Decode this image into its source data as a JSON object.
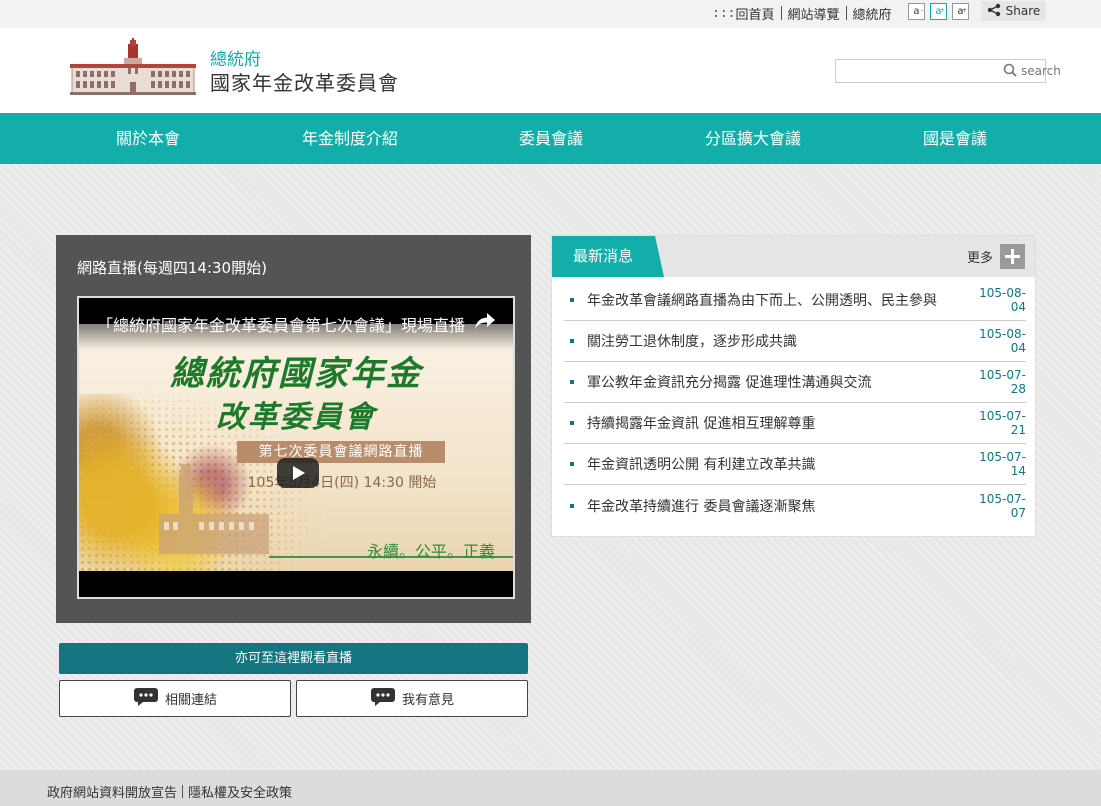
{
  "toplinks": {
    "accesskey": ":::",
    "home": "回首頁",
    "sitemap": "網站導覽",
    "president": "總統府"
  },
  "fontsize": {
    "small": "a",
    "medium": "a",
    "large": "a",
    "active": "medium"
  },
  "share": {
    "label": "Share"
  },
  "header": {
    "org_line1": "總統府",
    "org_line2": "國家年金改革委員會"
  },
  "search": {
    "placeholder": "",
    "button_label": "search"
  },
  "nav": {
    "items": [
      {
        "label": "關於本會"
      },
      {
        "label": "年金制度介紹"
      },
      {
        "label": "委員會議"
      },
      {
        "label": "分區擴大會議"
      },
      {
        "label": "國是會議"
      }
    ]
  },
  "live": {
    "title": "網路直播(每週四14:30開始)",
    "video_title": "「總統府國家年金改革委員會第七次會議」現場直播",
    "thumb_line1": "總統府國家年金",
    "thumb_line2": "改革委員會",
    "thumb_band": "第七次委員會議網路直播",
    "thumb_date": "105年8月4日(四) 14:30 開始",
    "thumb_slogan": "永續。公平。正義",
    "watch_button": "亦可至這裡觀看直播",
    "related_links": "相關連結",
    "feedback": "我有意見"
  },
  "news": {
    "tab": "最新消息",
    "more": "更多",
    "items": [
      {
        "title": "年金改革會議網路直播為由下而上、公開透明、民主參與",
        "date": "105-08-04"
      },
      {
        "title": "關注勞工退休制度，逐步形成共識",
        "date": "105-08-04"
      },
      {
        "title": "軍公教年金資訊充分揭露 促進理性溝通與交流",
        "date": "105-07-28"
      },
      {
        "title": "持續揭露年金資訊 促進相互理解尊重",
        "date": "105-07-21"
      },
      {
        "title": "年金資訊透明公開 有利建立改革共識",
        "date": "105-07-14"
      },
      {
        "title": "年金改革持續進行 委員會議逐漸聚焦",
        "date": "105-07-07"
      }
    ]
  },
  "footer": {
    "open_data": "政府網站資料開放宣告",
    "privacy": "隱私權及安全政策"
  },
  "colors": {
    "brand_teal": "#14aeaa",
    "dark_teal": "#137580",
    "panel_dark": "#545454"
  }
}
